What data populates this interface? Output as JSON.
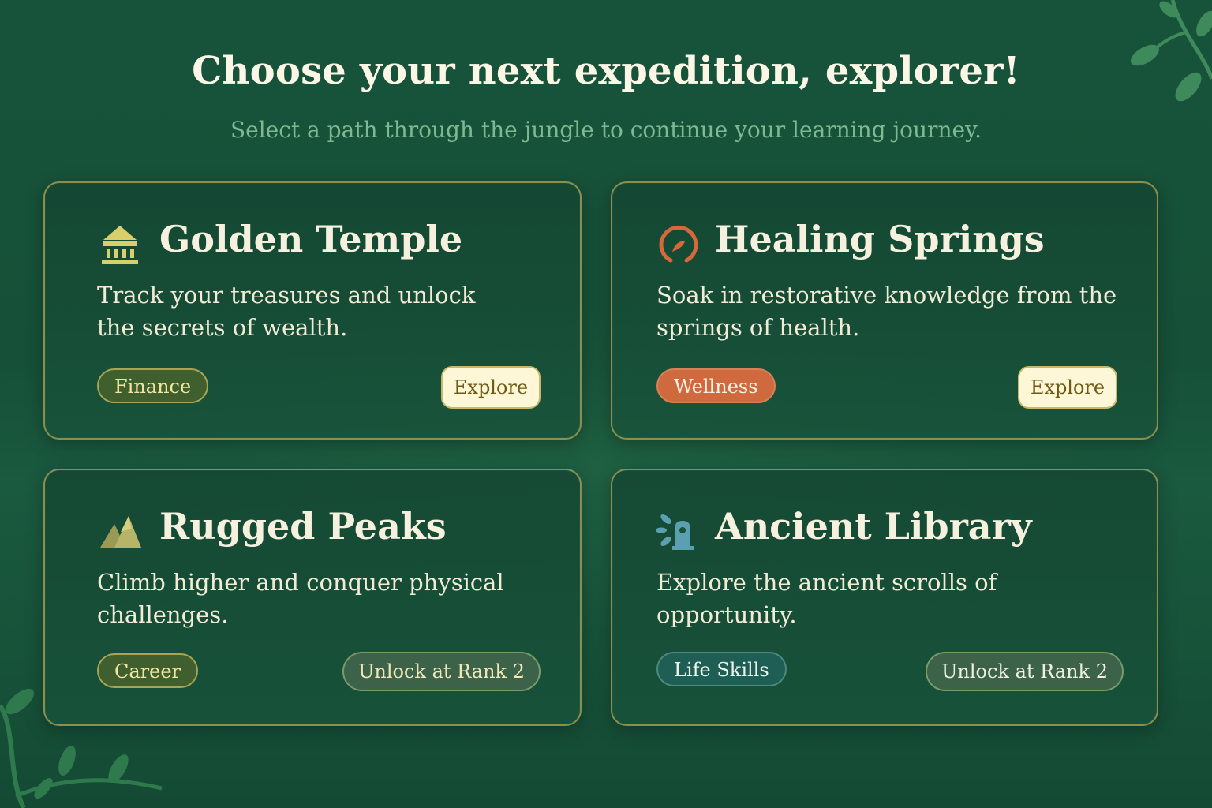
{
  "header": {
    "title": "Choose your next expedition, explorer!",
    "subtitle": "Select a path through the jungle to continue your learning journey."
  },
  "cards": [
    {
      "title": "Golden Temple",
      "description": "Track your treasures and unlock the secrets of wealth.",
      "icon": "temple-icon",
      "tag": "Finance",
      "action": "Explore",
      "locked": false
    },
    {
      "title": "Healing Springs",
      "description": "Soak in restorative knowledge from the springs of health.",
      "icon": "springs-icon",
      "tag": "Wellness",
      "action": "Explore",
      "locked": false
    },
    {
      "title": "Rugged Peaks",
      "description": "Climb higher and conquer physical challenges.",
      "icon": "mountain-icon",
      "tag": "Career",
      "action": "Unlock at Rank 2",
      "locked": true
    },
    {
      "title": "Ancient Library",
      "description": "Explore the ancient scrolls of opportunity.",
      "icon": "library-icon",
      "tag": "Life Skills",
      "action": "Unlock at Rank 2",
      "locked": true
    }
  ],
  "colors": {
    "background": "#17533a",
    "card_border": "#8a8f4e",
    "gold": "#d8cf6a",
    "wellness": "#cf6a3e",
    "explore_button": "#fdf7d8",
    "subtitle": "#7fb891"
  }
}
